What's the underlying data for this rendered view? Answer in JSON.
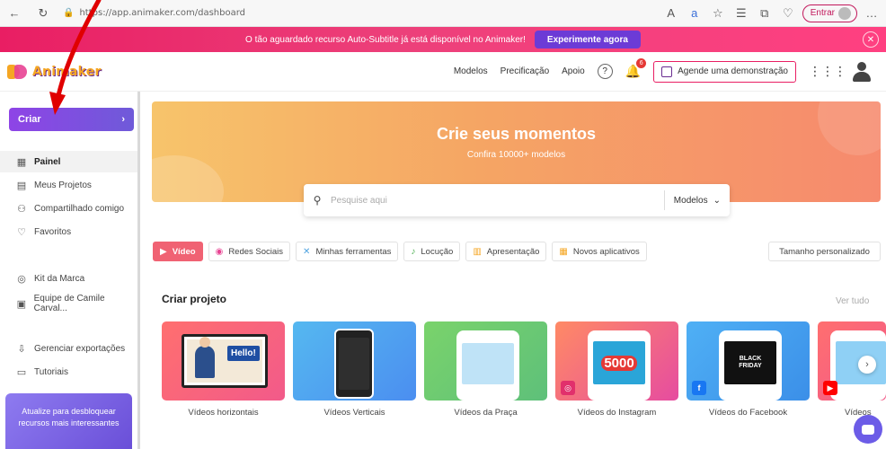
{
  "browser": {
    "url": "https://app.animaker.com/dashboard",
    "signin_label": "Entrar",
    "icons": [
      "back-icon",
      "reload-icon",
      "lock-icon",
      "read-aloud-icon",
      "translate-icon",
      "favorite-icon",
      "favorites-bar-icon",
      "collections-icon",
      "extensions-icon",
      "profile-icon",
      "more-icon"
    ]
  },
  "promo": {
    "text": "O tão aguardado recurso Auto-Subtitle já está disponível no Animaker!",
    "cta": "Experimente agora"
  },
  "header": {
    "logo": "Animaker",
    "nav": [
      "Modelos",
      "Precificação",
      "Apoio"
    ],
    "notification_count": "6",
    "demo_button": "Agende uma demonstração"
  },
  "sidebar": {
    "create_label": "Criar",
    "items": [
      {
        "label": "Painel",
        "icon": "dashboard-icon",
        "active": true
      },
      {
        "label": "Meus Projetos",
        "icon": "projects-icon"
      },
      {
        "label": "Compartilhado comigo",
        "icon": "shared-icon"
      },
      {
        "label": "Favoritos",
        "icon": "heart-icon"
      },
      {
        "label": "Kit da Marca",
        "icon": "brand-kit-icon"
      },
      {
        "label": "Equipe de Camile Carval...",
        "icon": "team-icon"
      },
      {
        "label": "Gerenciar exportações",
        "icon": "export-icon"
      },
      {
        "label": "Tutoriais",
        "icon": "tutorial-icon"
      }
    ],
    "upgrade_text": "Atualize para desbloquear recursos mais interessantes"
  },
  "hero": {
    "title": "Crie seus momentos",
    "subtitle": "Confira 10000+ modelos"
  },
  "search": {
    "placeholder": "Pesquise aqui",
    "scope": "Modelos"
  },
  "categories": {
    "tabs": [
      {
        "label": "Vídeo",
        "active": true
      },
      {
        "label": "Redes Sociais"
      },
      {
        "label": "Minhas ferramentas"
      },
      {
        "label": "Locução"
      },
      {
        "label": "Apresentação"
      },
      {
        "label": "Novos aplicativos"
      }
    ],
    "custom_size": "Tamanho personalizado"
  },
  "projects": {
    "title": "Criar projeto",
    "see_all": "Ver tudo",
    "cards": [
      {
        "label": "Vídeos horizontais",
        "thumb_text": "Hello!"
      },
      {
        "label": "Vídeos Verticais"
      },
      {
        "label": "Vídeos da Praça"
      },
      {
        "label": "Vídeos do Instagram",
        "thumb_text": "5000"
      },
      {
        "label": "Vídeos do Facebook",
        "thumb_text": "BLACK FRIDAY"
      },
      {
        "label": "Vídeos"
      }
    ]
  },
  "colors": {
    "promo": "#e91e63",
    "create_button": "#7b4fe0",
    "active_tab": "#f06273",
    "hero": "#f5a564",
    "annotation_arrow": "#e00000"
  }
}
